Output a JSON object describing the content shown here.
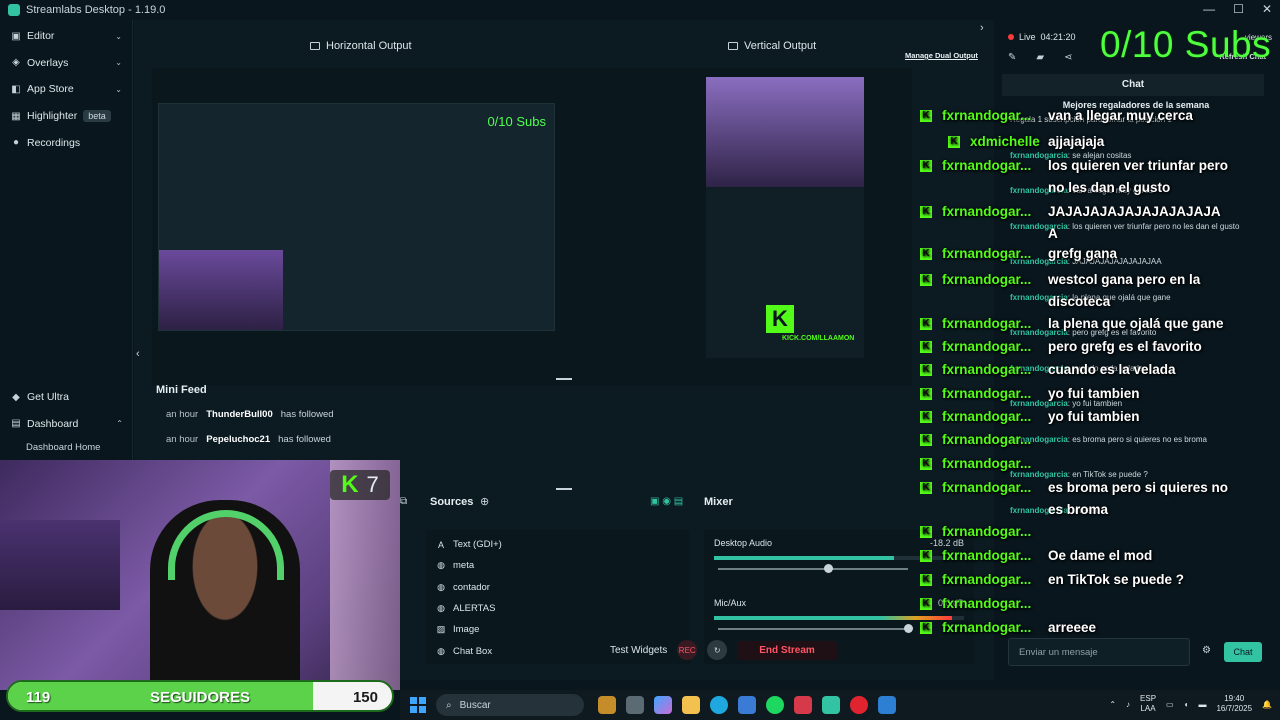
{
  "window": {
    "title": "Streamlabs Desktop - 1.19.0",
    "controls": [
      "—",
      "☐",
      "✕"
    ]
  },
  "nav": {
    "items": [
      {
        "label": "Editor",
        "icon": "editor-icon",
        "glyph": "▣",
        "chevron": "⌄"
      },
      {
        "label": "Overlays",
        "icon": "overlays-icon",
        "glyph": "◈",
        "chevron": "⌄"
      },
      {
        "label": "App Store",
        "icon": "app-store-icon",
        "glyph": "◧",
        "chevron": "⌄"
      },
      {
        "label": "Highlighter",
        "icon": "highlighter-icon",
        "glyph": "▦",
        "badge": "beta"
      },
      {
        "label": "Recordings",
        "icon": "recordings-icon",
        "glyph": "●"
      }
    ],
    "get_ultra": "Get Ultra",
    "dashboard": "Dashboard",
    "dashboard_home": "Dashboard Home"
  },
  "editor": {
    "horizontal_output": "Horizontal Output",
    "vertical_output": "Vertical Output",
    "manage_dual_output": "Manage Dual Output",
    "scene_subs_text": "0/10 Subs",
    "kick_url": "KICK.COM/LLAAMON"
  },
  "mini_feed": {
    "title": "Mini Feed",
    "rows": [
      {
        "time": "an hour",
        "user": "ThunderBull00",
        "action": "has followed"
      },
      {
        "time": "an hour",
        "user": "Pepeluchoc21",
        "action": "has followed"
      }
    ]
  },
  "sources": {
    "title": "Sources",
    "items": [
      {
        "label": "Text (GDI+)",
        "icon": "text-icon",
        "glyph": "A"
      },
      {
        "label": "meta",
        "icon": "globe-icon",
        "glyph": "◍"
      },
      {
        "label": "contador",
        "icon": "globe-icon",
        "glyph": "◍"
      },
      {
        "label": "ALERTAS",
        "icon": "globe-icon",
        "glyph": "◍"
      },
      {
        "label": "Image",
        "icon": "image-icon",
        "glyph": "▨"
      },
      {
        "label": "Chat Box",
        "icon": "globe-icon",
        "glyph": "◍"
      }
    ]
  },
  "mixer": {
    "title": "Mixer",
    "channels": [
      {
        "name": "Desktop Audio",
        "db": "-18.2 dB",
        "level": 0.72,
        "volume": 0.58
      },
      {
        "name": "Mic/Aux",
        "db": "0.0 dB",
        "level": 0.95,
        "volume": 1.0
      }
    ]
  },
  "footer": {
    "test_widgets": "Test Widgets",
    "rec_label": "REC",
    "end_stream": "End Stream"
  },
  "right_panel": {
    "live_label": "Live",
    "live_time": "04:21:20",
    "viewers_label": "viewers",
    "refresh_chat": "Refresh Chat",
    "chat_tab": "Chat",
    "chat_inner_title": "Mejores regaladores de la semana",
    "chat_inner_lines": [
      {
        "user": "",
        "text": "Regala 1 suscripción para tomar la posición 1"
      },
      {
        "user": "fxrnandogarcia",
        "text": ": se alejan cositas"
      },
      {
        "user": "fxrnandogarcia",
        "text": ": van a llegar muy cerca"
      },
      {
        "user": "fxrnandogarcia",
        "text": ": los quieren ver triunfar pero no les dan el gusto"
      },
      {
        "user": "fxrnandogarcia",
        "text": ": JAJAJAJAJAJAJAJAJAA"
      },
      {
        "user": "fxrnandogarcia",
        "text": ": la plena que ojalá que gane"
      },
      {
        "user": "fxrnandogarcia",
        "text": ": pero grefg es el favorito"
      },
      {
        "user": "fxrnandogarcia",
        "text": ": cuando es la velada"
      },
      {
        "user": "fxrnandogarcia",
        "text": ": yo fui tambien"
      },
      {
        "user": "fxrnandogarcia",
        "text": ": es broma pero si quieres no es broma"
      },
      {
        "user": "fxrnandogarcia",
        "text": ": en TikTok se puede ?"
      },
      {
        "user": "fxrnandogarcia",
        "text": ": arreeee"
      }
    ],
    "chat_input_placeholder": "Enviar un mensaje",
    "chat_button": "Chat"
  },
  "overlay": {
    "subs_goal": "0/10 Subs",
    "kick_chat": [
      {
        "user": "fxrnandogar...",
        "lines": [
          "van a llegar muy cerca"
        ]
      },
      {
        "user": "xdmichelle",
        "lines": [
          "ajjajajaja"
        ]
      },
      {
        "user": "fxrnandogar...",
        "lines": [
          "los quieren ver triunfar pero",
          "no les dan el gusto"
        ]
      },
      {
        "user": "fxrnandogar...",
        "lines": [
          "JAJAJAJAJAJAJAJAJAJA",
          "A"
        ]
      },
      {
        "user": "fxrnandogar...",
        "lines": [
          "grefg gana"
        ]
      },
      {
        "user": "fxrnandogar...",
        "lines": [
          "westcol gana pero en la",
          "discoteca"
        ]
      },
      {
        "user": "fxrnandogar...",
        "lines": [
          "la plena que ojalá que gane"
        ]
      },
      {
        "user": "fxrnandogar...",
        "lines": [
          "pero grefg es el favorito"
        ]
      },
      {
        "user": "fxrnandogar...",
        "lines": [
          "cuando es la velada"
        ]
      },
      {
        "user": "fxrnandogar...",
        "lines": [
          "yo fui tambien"
        ]
      },
      {
        "user": "fxrnandogar...",
        "lines": [
          "yo fui tambien"
        ]
      },
      {
        "user": "fxrnandogar...",
        "lines": [
          ""
        ]
      },
      {
        "user": "fxrnandogar...",
        "lines": [
          ""
        ]
      },
      {
        "user": "fxrnandogar...",
        "lines": [
          "es broma pero si quieres no",
          "es broma"
        ]
      },
      {
        "user": "fxrnandogar...",
        "lines": [
          ""
        ]
      },
      {
        "user": "fxrnandogar...",
        "lines": [
          "Oe dame el mod"
        ]
      },
      {
        "user": "fxrnandogar...",
        "lines": [
          "en TikTok se puede ?"
        ]
      },
      {
        "user": "fxrnandogar...",
        "lines": [
          ""
        ]
      },
      {
        "user": "fxrnandogar...",
        "lines": [
          "arreeee"
        ]
      }
    ],
    "webcam_badge_count": "7",
    "goal": {
      "current": "119",
      "label": "SEGUIDORES",
      "target": "150",
      "progress": 0.793
    }
  },
  "taskbar": {
    "search": "Buscar",
    "lang_top": "ESP",
    "lang_bottom": "LAA",
    "time": "19:40",
    "date": "16/7/2025"
  },
  "colors": {
    "accent": "#31c3a2",
    "kick_green": "#53fc18",
    "end_stream": "#ff5566"
  }
}
